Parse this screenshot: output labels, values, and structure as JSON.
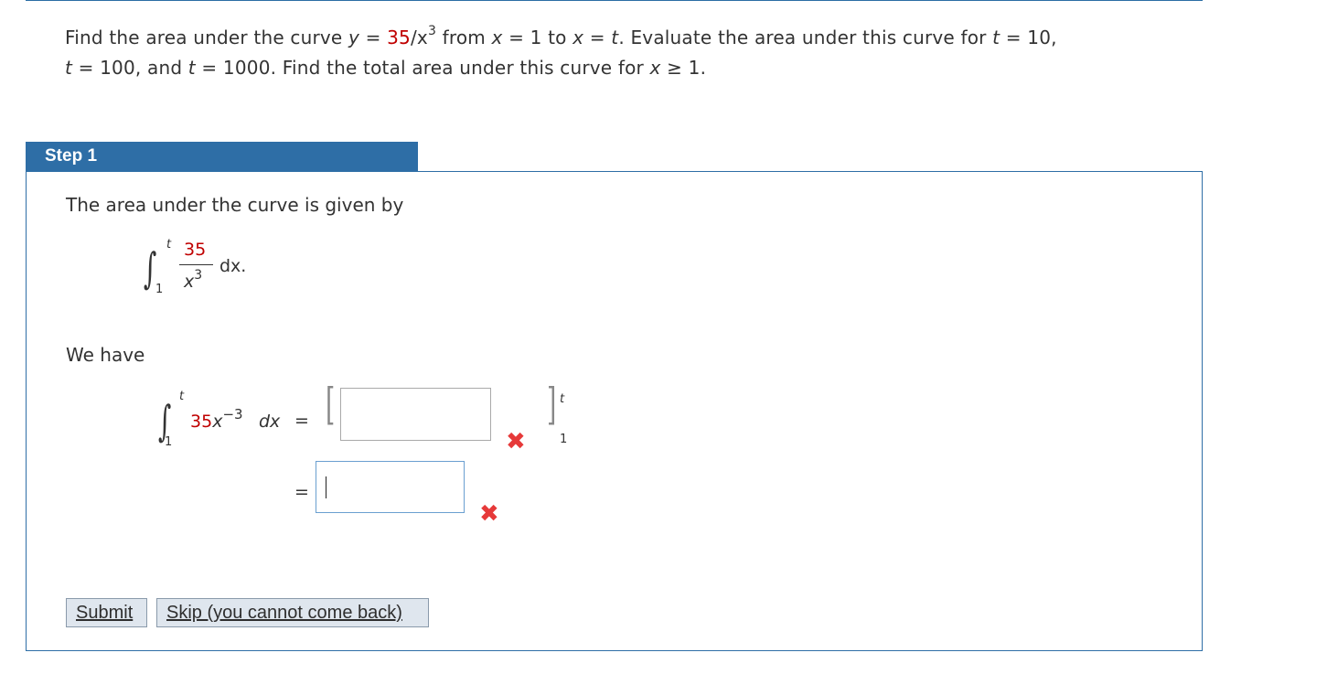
{
  "problem": {
    "part1": "Find the area under the curve ",
    "y": "y",
    "eq1": " = ",
    "coef": "35",
    "slash_x": "/x",
    "exp": "3",
    "from": " from ",
    "x1": "x",
    "eq2": " = 1 to ",
    "x2": "x",
    "eq3": " = ",
    "t1": "t",
    "evaluate": ". Evaluate the area under this curve for ",
    "t2": "t",
    "eq4": " = 10,",
    "t3": "t",
    "eq5": " = 100, and ",
    "t4": "t",
    "eq6": " = 1000. Find the total area under this curve for ",
    "x3": "x",
    "ge": " ≥ 1."
  },
  "step": {
    "header": "Step 1",
    "intro": "The area under the curve is given by",
    "integral1": {
      "upper": "t",
      "lower": "1",
      "numerator": "35",
      "denominator_base": "x",
      "denominator_exp": "3",
      "dx": "dx."
    },
    "we_have": "We have",
    "integral2": {
      "upper": "t",
      "lower": "1",
      "coef": "35",
      "base": "x",
      "exp": "−3",
      "dx": "dx",
      "eq": "="
    },
    "eval_upper": "t",
    "eval_lower": "1",
    "eq2": "=",
    "answer1_value": "",
    "answer2_value": "",
    "incorrect_mark": "✖",
    "buttons": {
      "submit": "Submit",
      "skip": "Skip (you cannot come back)"
    }
  },
  "colors": {
    "header_bg": "#2e6ea6",
    "accent_red": "#c00000",
    "error_x": "#e63939"
  }
}
